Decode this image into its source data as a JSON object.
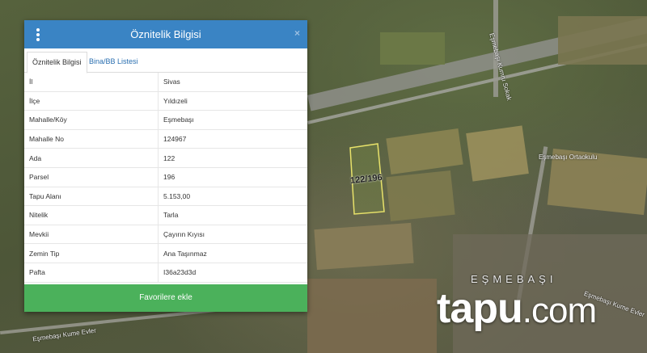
{
  "panel": {
    "title": "Öznitelik Bilgisi",
    "close_label": "×",
    "tabs": [
      {
        "label": "Öznitelik Bilgisi"
      },
      {
        "label": "Bina/BB Listesi"
      }
    ],
    "rows": [
      {
        "key": "İl",
        "value": "Sivas"
      },
      {
        "key": "İlçe",
        "value": "Yıldızeli"
      },
      {
        "key": "Mahalle/Köy",
        "value": "Eşmebaşı"
      },
      {
        "key": "Mahalle No",
        "value": "124967"
      },
      {
        "key": "Ada",
        "value": "122"
      },
      {
        "key": "Parsel",
        "value": "196"
      },
      {
        "key": "Tapu Alanı",
        "value": "5.153,00"
      },
      {
        "key": "Nitelik",
        "value": "Tarla"
      },
      {
        "key": "Mevkii",
        "value": "Çayırın Kıyısı"
      },
      {
        "key": "Zemin Tip",
        "value": "Ana Taşınmaz"
      },
      {
        "key": "Pafta",
        "value": "I36a23d3d"
      }
    ],
    "favorite_button": "Favorilere ekle"
  },
  "map": {
    "parcel_label": "122/196",
    "labels": {
      "school": "Eşmebaşı Ortaokulu",
      "village": "EŞMEBAŞI",
      "street_top": "Eşmebaşı Kumru Sokak",
      "street_bottom": "Eşmebaşı Kume Evler",
      "street_right": "Eşmebaşı Kume Evler"
    },
    "brand": {
      "name": "tapu",
      "dot": ".",
      "tld": "com"
    },
    "parcel_color": "#e8e26a"
  },
  "colors": {
    "header": "#3a84c4",
    "button": "#4bb15b",
    "tab_link": "#2a6fb0"
  }
}
